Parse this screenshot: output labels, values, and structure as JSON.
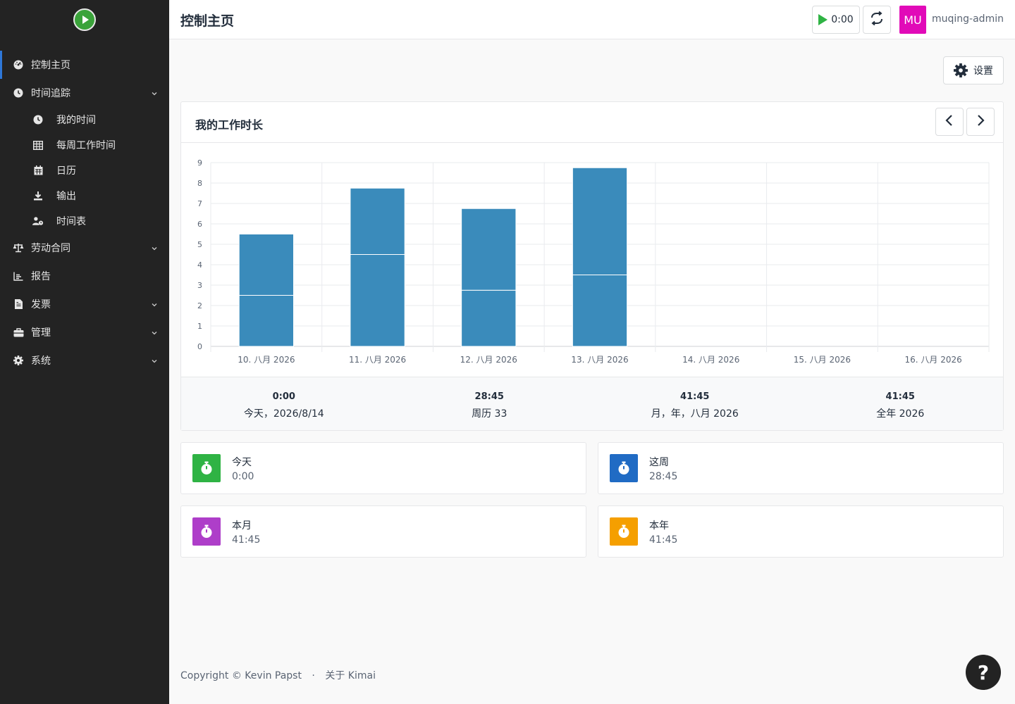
{
  "header": {
    "title": "控制主页",
    "timer": "0:00",
    "avatar_initials": "MU",
    "avatar_color": "#e10ab8",
    "username": "muqing-admin"
  },
  "sidebar": {
    "items": [
      {
        "label": "控制主页",
        "icon": "dashboard-icon"
      },
      {
        "label": "时间追踪",
        "icon": "clock-icon"
      },
      {
        "label": "我的时间",
        "icon": "clock-icon"
      },
      {
        "label": "每周工作时间",
        "icon": "grid-icon"
      },
      {
        "label": "日历",
        "icon": "calendar-icon"
      },
      {
        "label": "输出",
        "icon": "download-icon"
      },
      {
        "label": "时间表",
        "icon": "user-clock-icon"
      },
      {
        "label": "劳动合同",
        "icon": "balance-icon"
      },
      {
        "label": "报告",
        "icon": "chart-icon"
      },
      {
        "label": "发票",
        "icon": "invoice-icon"
      },
      {
        "label": "管理",
        "icon": "toolbox-icon"
      },
      {
        "label": "系统",
        "icon": "gear-icon"
      }
    ]
  },
  "main": {
    "settings_label": "设置",
    "chart_title": "我的工作时长",
    "summary": [
      {
        "value": "0:00",
        "label": "今天，2026/8/14"
      },
      {
        "value": "28:45",
        "label": "周历 33"
      },
      {
        "value": "41:45",
        "label": "月，年，八月 2026"
      },
      {
        "value": "41:45",
        "label": "全年 2026"
      }
    ],
    "stats": [
      {
        "label": "今天",
        "value": "0:00",
        "color": "#2fb344"
      },
      {
        "label": "这周",
        "value": "28:45",
        "color": "#206bc4"
      },
      {
        "label": "本月",
        "value": "41:45",
        "color": "#ae3ec9"
      },
      {
        "label": "本年",
        "value": "41:45",
        "color": "#f59f00"
      }
    ]
  },
  "chart_data": {
    "type": "bar",
    "stacked": true,
    "categories": [
      "10. 八月 2026",
      "11. 八月 2026",
      "12. 八月 2026",
      "13. 八月 2026",
      "14. 八月 2026",
      "15. 八月 2026",
      "16. 八月 2026"
    ],
    "series": [
      {
        "values": [
          2.5,
          4.5,
          2.75,
          3.5,
          0,
          0,
          0
        ],
        "color": "#3a8bbb"
      },
      {
        "values": [
          3.0,
          3.25,
          4.0,
          5.25,
          0,
          0,
          0
        ],
        "color": "#3a8bbb"
      }
    ],
    "ylim": [
      0,
      9
    ],
    "yticks": [
      "0",
      "1",
      "2",
      "3",
      "4",
      "5",
      "6",
      "7",
      "8",
      "9"
    ],
    "grid": true,
    "legend": "none"
  },
  "footer": {
    "copyright": "Copyright © Kevin Papst",
    "separator": "·",
    "about": "关于 Kimai"
  }
}
